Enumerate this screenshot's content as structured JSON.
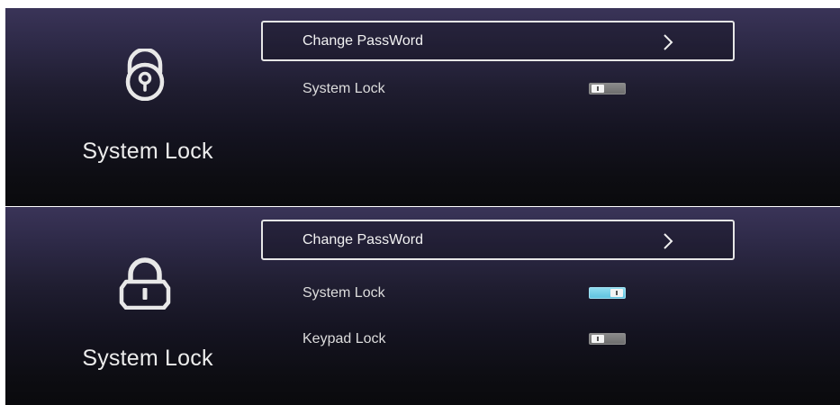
{
  "top_panel": {
    "side_title": "System Lock",
    "lock_icon": "lock-open-keyhole-icon",
    "focus_item": {
      "label": "Change PassWord",
      "icon": "chevron-right-icon"
    },
    "rows": [
      {
        "label": "System Lock",
        "toggle_state": "off"
      }
    ]
  },
  "bottom_panel": {
    "side_title": "System Lock",
    "lock_icon": "lock-closed-icon",
    "focus_item": {
      "label": "Change PassWord",
      "icon": "chevron-right-icon"
    },
    "rows": [
      {
        "label": "System Lock",
        "toggle_state": "on"
      },
      {
        "label": "Keypad Lock",
        "toggle_state": "off"
      }
    ]
  },
  "colors": {
    "panel_top": "#3a3458",
    "panel_bottom": "#0a0a0d",
    "focus_border": "#e6e6e6",
    "toggle_on": "#6ccbe6",
    "toggle_off": "#7c7c7c"
  }
}
